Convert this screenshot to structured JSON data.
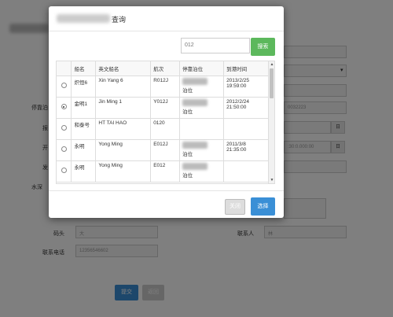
{
  "modal": {
    "title": "查询",
    "search": {
      "value": "012",
      "button": "搜索"
    },
    "columns": [
      "",
      "船名",
      "英文船名",
      "航次",
      "停靠泊位",
      "到港时间"
    ],
    "rows": [
      {
        "checked": false,
        "name": "炽恒6",
        "en": "Xin Yang 6",
        "voyage": "R012J",
        "berth": "泊位",
        "time1": "2013/2/25",
        "time2": "19:59:00"
      },
      {
        "checked": true,
        "name": "金明1",
        "en": "Jin Ming 1",
        "voyage": "Y012J",
        "berth": "泊位",
        "time1": "2012/2/24",
        "time2": "21:50:00"
      },
      {
        "checked": false,
        "name": "和泰号",
        "en": "HT TAI HAO",
        "voyage": "0120",
        "berth": "",
        "time1": "",
        "time2": ""
      },
      {
        "checked": false,
        "name": "永明",
        "en": "Yong Ming",
        "voyage": "E012J",
        "berth": "泊位",
        "time1": "2011/3/8",
        "time2": "21:35:00"
      },
      {
        "checked": false,
        "name": "永明",
        "en": "Yong Ming",
        "voyage": "E012",
        "berth": "泊位",
        "time1": "",
        "time2": ""
      }
    ],
    "footer": {
      "close": "关闭",
      "select": "选择"
    }
  },
  "background": {
    "labels": {
      "berth": "停靠泊",
      "a": "报",
      "b": "开",
      "c": "发",
      "water": "水深",
      "head": "码头",
      "contact": "联系人",
      "phone": "联系电话"
    },
    "fields": {
      "date_value": "0032223",
      "time_value": ":30:0.000:00",
      "head_value": "大",
      "contact_value": "林",
      "phone_value": "12356546602"
    },
    "buttons": {
      "submit": "提交",
      "back": "返回"
    },
    "addon": "日"
  }
}
